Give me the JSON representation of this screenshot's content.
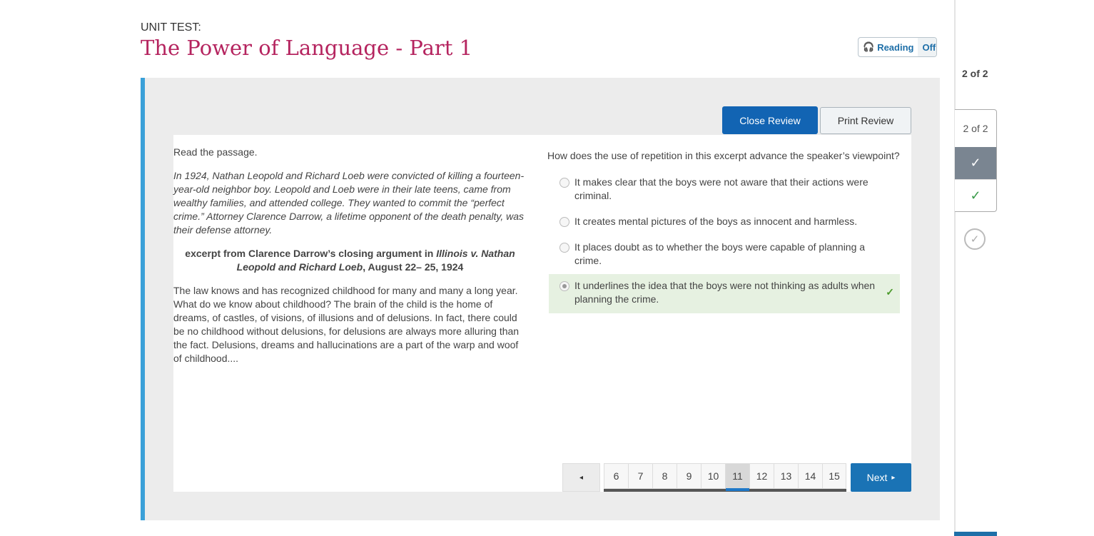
{
  "header": {
    "unit_label": "UNIT TEST:",
    "title": "The Power of Language - Part 1",
    "reading_label": "Reading",
    "reading_state": "Off"
  },
  "sidebar": {
    "count_top": "2 of 2",
    "count_box": "2 of 2"
  },
  "toolbar": {
    "close_review": "Close Review",
    "print_review": "Print Review"
  },
  "passage": {
    "instruction": "Read the passage.",
    "intro": "In 1924, Nathan Leopold and Richard Loeb were convicted of killing a fourteen-year-old neighbor boy. Leopold and Loeb were in their late teens, came from wealthy families, and attended college. They wanted to commit the “perfect crime.” Attorney Clarence Darrow, a lifetime opponent of the death penalty, was their defense attorney.",
    "excerpt_prefix": "excerpt from Clarence Darrow’s closing argument in ",
    "excerpt_case": "Illinois v. Nathan Leopold and Richard Loeb",
    "excerpt_date": ", August 22– 25, 1924",
    "body": "The law knows and has recognized childhood for many and many a long year. What do we know about childhood? The brain of the child is the home of dreams, of castles, of visions, of illusions and of delusions. In fact, there could be no childhood without delusions, for delusions are always more alluring than the fact. Delusions, dreams and hallucinations are a part of the warp and woof of childhood...."
  },
  "question": {
    "text": "How does the use of repetition in this excerpt advance the speaker’s viewpoint?",
    "options": [
      {
        "label": "It makes clear that the boys were not aware that their actions were criminal."
      },
      {
        "label": "It creates mental pictures of the boys as innocent and harmless."
      },
      {
        "label": "It places doubt as to whether the boys were capable of planning a crime."
      },
      {
        "label": "It underlines the idea that the boys were not thinking as adults when planning the crime.",
        "selected": true,
        "correct": true
      }
    ]
  },
  "pagination": {
    "prev": "◂",
    "pages": [
      "6",
      "7",
      "8",
      "9",
      "10",
      "11",
      "12",
      "13",
      "14",
      "15"
    ],
    "current": "11",
    "next": "Next",
    "next_arrow": "▸"
  },
  "colors": {
    "accent": "#1264b3",
    "title": "#b5245f",
    "correct": "#e6f1e1"
  }
}
